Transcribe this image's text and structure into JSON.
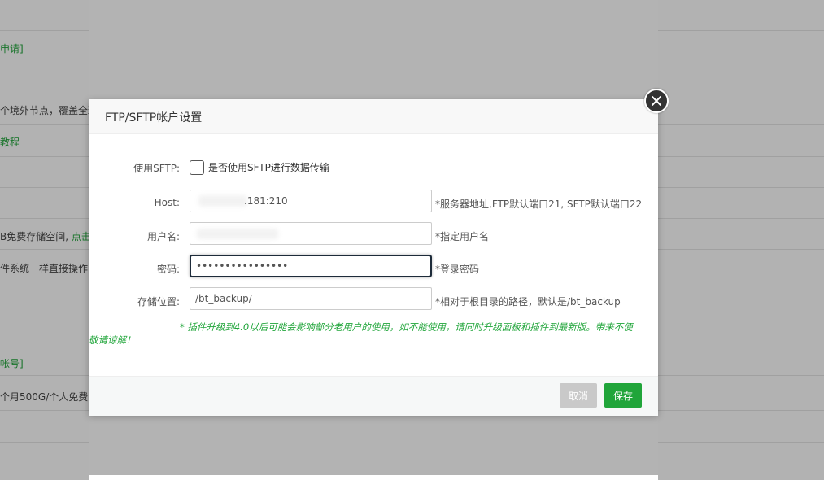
{
  "background": {
    "lines": [
      {
        "text": "申请]",
        "green": true
      },
      {
        "text": "个境外节点，覆盖全球",
        "green": false
      },
      {
        "text": "教程",
        "green": true
      },
      {
        "text": "B免费存储空间,",
        "green": false,
        "tail": "点击"
      },
      {
        "text": "件系统一样直接操作",
        "green": false
      },
      {
        "text": "帐号]",
        "green": true
      },
      {
        "text": "个月500G/个人免费",
        "green": false
      }
    ]
  },
  "dialog": {
    "title": "FTP/SFTP帐户设置",
    "sftp": {
      "label": "使用SFTP:",
      "description": "是否使用SFTP进行数据传输",
      "checked": false
    },
    "host": {
      "label": "Host:",
      "value": ".181:210",
      "hint": "*服务器地址,FTP默认端口21, SFTP默认端口22"
    },
    "username": {
      "label": "用户名:",
      "value": "",
      "hint": "*指定用户名"
    },
    "password": {
      "label": "密码:",
      "value": "••••••••••••••••",
      "hint": "*登录密码"
    },
    "storage": {
      "label": "存储位置:",
      "value": "/bt_backup/",
      "hint": "*相对于根目录的路径，默认是/bt_backup"
    },
    "notice_line1": "*  插件升级到4.0以后可能会影响部分老用户的使用，如不能使用，请同时升级面板和插件到最新版。带来不便",
    "notice_line2": "敬请谅解！",
    "cancel_label": "取消",
    "save_label": "保存"
  },
  "colors": {
    "accent": "#20a53a",
    "cancel": "#c9c9c9",
    "overlay": "#b3b3b3"
  },
  "icons": {
    "close": "close-icon"
  }
}
